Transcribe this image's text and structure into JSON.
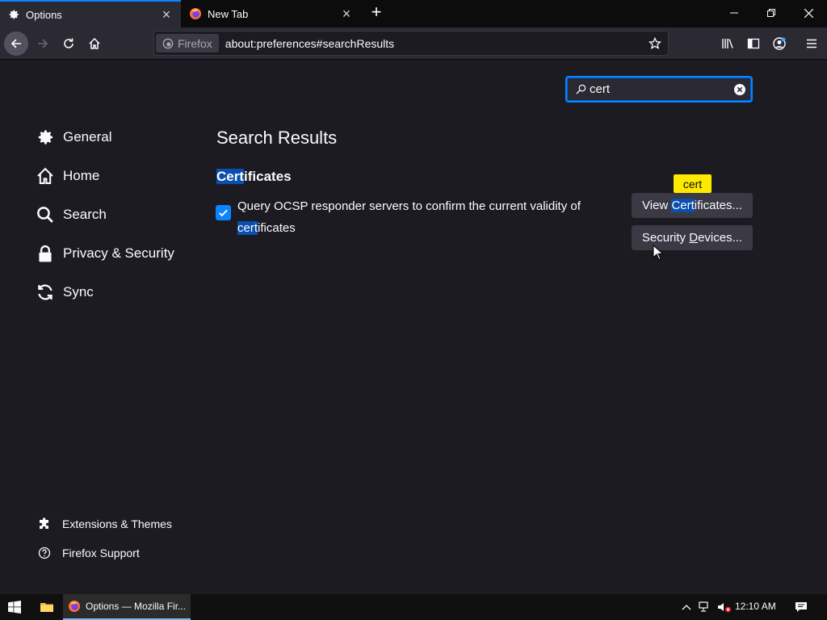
{
  "tabs": [
    {
      "title": "Options",
      "active": true
    },
    {
      "title": "New Tab",
      "active": false
    }
  ],
  "urlbar": {
    "identity_label": "Firefox",
    "url": "about:preferences#searchResults"
  },
  "search": {
    "value": "cert"
  },
  "sidebar": {
    "categories": [
      {
        "label": "General",
        "icon": "gear-icon"
      },
      {
        "label": "Home",
        "icon": "home-icon"
      },
      {
        "label": "Search",
        "icon": "search-icon"
      },
      {
        "label": "Privacy & Security",
        "icon": "lock-icon"
      },
      {
        "label": "Sync",
        "icon": "sync-icon"
      }
    ],
    "footer": [
      {
        "label": "Extensions & Themes",
        "icon": "puzzle-icon"
      },
      {
        "label": "Firefox Support",
        "icon": "help-icon"
      }
    ]
  },
  "main": {
    "title": "Search Results",
    "group_title_hl": "Cert",
    "group_title_rest": "ificates",
    "ocsp_label_line1": "Query OCSP responder servers to confirm the current validity of",
    "ocsp_label_hl": "cert",
    "ocsp_label_rest": "ificates",
    "ocsp_checked": true,
    "view_btn_pre": "View ",
    "view_btn_hl": "Cert",
    "view_btn_post": "ificates...",
    "security_btn_pre": "Security ",
    "security_btn_ul": "D",
    "security_btn_post": "evices...",
    "tooltip": "cert"
  },
  "taskbar": {
    "app_label": "Options — Mozilla Fir...",
    "clock": "12:10 AM"
  },
  "colors": {
    "accent": "#0a84ff",
    "highlight": "#0b4fae",
    "tooltip": "#ffe900",
    "background": "#1c1b22"
  }
}
